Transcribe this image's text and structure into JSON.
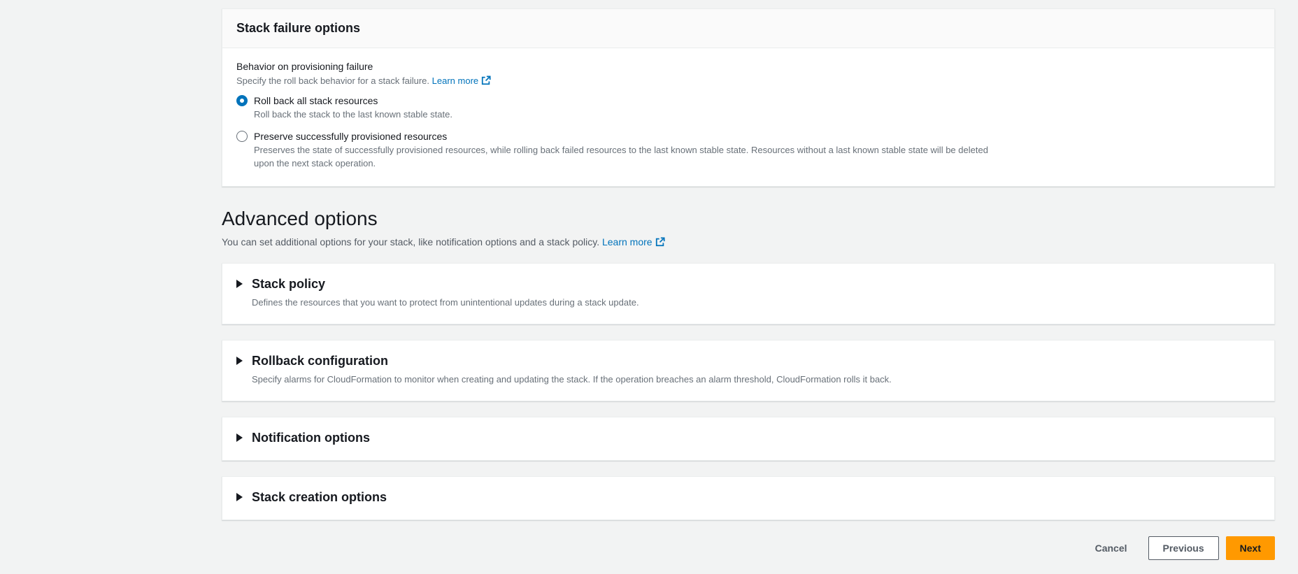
{
  "stack_failure_card": {
    "title": "Stack failure options",
    "field": {
      "label": "Behavior on provisioning failure",
      "description": "Specify the roll back behavior for a stack failure.",
      "learn_more_label": "Learn more"
    },
    "radios": [
      {
        "label": "Roll back all stack resources",
        "description": "Roll back the stack to the last known stable state.",
        "selected": true
      },
      {
        "label": "Preserve successfully provisioned resources",
        "description": "Preserves the state of successfully provisioned resources, while rolling back failed resources to the last known stable state. Resources without a last known stable state will be deleted upon the next stack operation.",
        "selected": false
      }
    ]
  },
  "advanced": {
    "title": "Advanced options",
    "description": "You can set additional options for your stack, like notification options and a stack policy.",
    "learn_more_label": "Learn more"
  },
  "sections": [
    {
      "title": "Stack policy",
      "description": "Defines the resources that you want to protect from unintentional updates during a stack update.",
      "expanded": false
    },
    {
      "title": "Rollback configuration",
      "description": "Specify alarms for CloudFormation to monitor when creating and updating the stack. If the operation breaches an alarm threshold, CloudFormation rolls it back.",
      "expanded": false
    },
    {
      "title": "Notification options",
      "description": "",
      "expanded": false
    },
    {
      "title": "Stack creation options",
      "description": "",
      "expanded": false
    }
  ],
  "footer": {
    "cancel_label": "Cancel",
    "previous_label": "Previous",
    "next_label": "Next"
  },
  "colors": {
    "page_background": "#f2f3f3",
    "link_blue": "#0073bb",
    "radio_selected_blue": "#0073bb",
    "primary_button_orange": "#ff9900",
    "primary_button_text": "#16191f",
    "secondary_text": "#687078"
  }
}
